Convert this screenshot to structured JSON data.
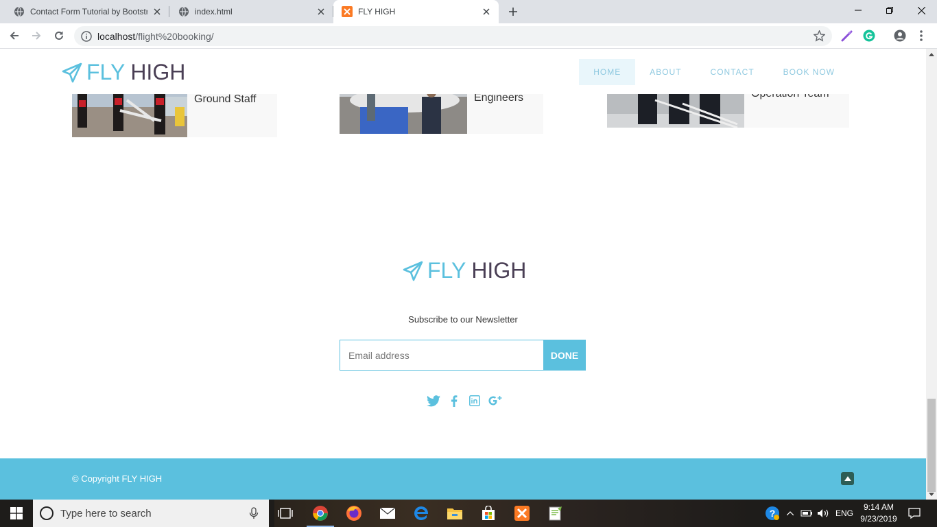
{
  "browser": {
    "tabs": [
      {
        "title": "Contact Form Tutorial by Bootstr",
        "active": false
      },
      {
        "title": "index.html",
        "active": false
      },
      {
        "title": "FLY HIGH",
        "active": true
      }
    ],
    "url_host": "localhost",
    "url_path": "/flight%20booking/"
  },
  "site": {
    "logo_fly": "FLY",
    "logo_high": "HIGH",
    "nav": [
      {
        "label": "HOME",
        "active": true
      },
      {
        "label": "ABOUT",
        "active": false
      },
      {
        "label": "CONTACT",
        "active": false
      },
      {
        "label": "BOOK NOW",
        "active": false
      }
    ],
    "team": [
      {
        "caption": "Ground Staff"
      },
      {
        "caption": "Engineers"
      },
      {
        "caption": "Operation Team"
      }
    ],
    "footer": {
      "subscribe_text": "Subscribe to our Newsletter",
      "email_placeholder": "Email address",
      "done_label": "DONE",
      "social_icons": [
        "twitter-icon",
        "facebook-icon",
        "linkedin-icon",
        "google-plus-icon"
      ],
      "copyright": "© Copyright FLY HIGH"
    },
    "colors": {
      "accent": "#5bc0de",
      "dark": "#4a3f55",
      "totop": "#2d5d55"
    }
  },
  "taskbar": {
    "search_placeholder": "Type here to search",
    "language": "ENG",
    "time": "9:14 AM",
    "date": "9/23/2019"
  }
}
